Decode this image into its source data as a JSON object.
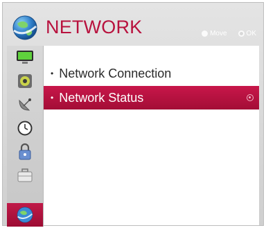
{
  "header": {
    "title": "NETWORK",
    "hint_move": "Move",
    "hint_ok": "OK"
  },
  "sidebar": {
    "items": [
      {
        "icon": "tv-picture-icon",
        "active": false
      },
      {
        "icon": "speaker-icon",
        "active": false
      },
      {
        "icon": "satellite-dish-icon",
        "active": false
      },
      {
        "icon": "clock-icon",
        "active": false
      },
      {
        "icon": "lock-icon",
        "active": false
      },
      {
        "icon": "briefcase-icon",
        "active": false
      },
      {
        "icon": "globe-icon",
        "active": true
      }
    ]
  },
  "menu": {
    "items": [
      {
        "label": "Network Connection",
        "selected": false
      },
      {
        "label": "Network Status",
        "selected": true
      }
    ]
  },
  "colors": {
    "accent": "#b8123e",
    "panel": "#d9d9d9"
  }
}
